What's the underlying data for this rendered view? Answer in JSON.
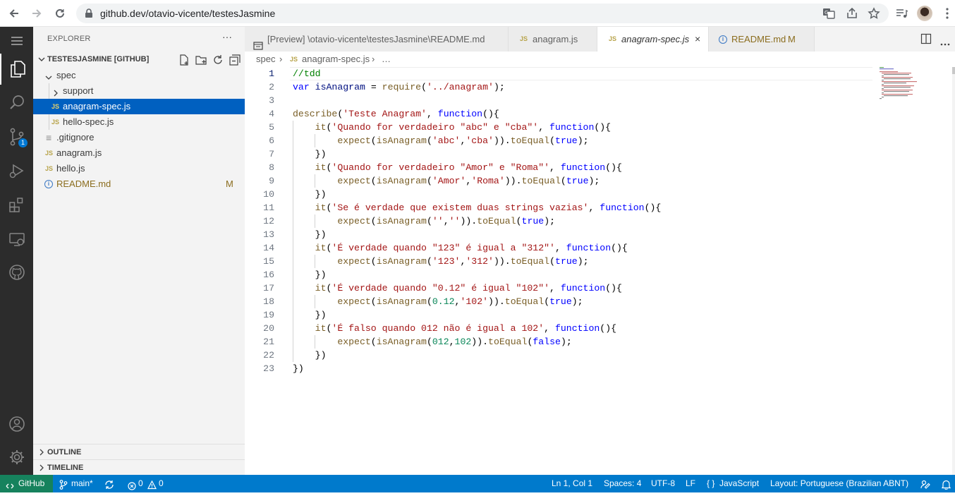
{
  "browser": {
    "url": "github.dev/otavio-vicente/testesJasmine"
  },
  "activity_bar": {
    "source_control_badge": "1"
  },
  "explorer": {
    "title": "EXPLORER",
    "more": "···",
    "section_title": "TESTESJASMINE [GITHUB]",
    "tree": [
      {
        "name": "spec",
        "type": "folder-open"
      },
      {
        "name": "support",
        "type": "folder"
      },
      {
        "name": "anagram-spec.js",
        "type": "js"
      },
      {
        "name": "hello-spec.js",
        "type": "js"
      },
      {
        "name": ".gitignore",
        "type": "file"
      },
      {
        "name": "anagram.js",
        "type": "js"
      },
      {
        "name": "hello.js",
        "type": "js"
      },
      {
        "name": "README.md",
        "type": "info",
        "status": "M"
      }
    ],
    "js_glyph": "JS",
    "outline": "OUTLINE",
    "timeline": "TIMELINE"
  },
  "tabs": [
    {
      "label": "[Preview] \\otavio-vicente\\testesJasmine\\README.md",
      "icon": "preview"
    },
    {
      "label": "anagram.js",
      "icon": "JS"
    },
    {
      "label": "anagram-spec.js",
      "icon": "JS",
      "active": true,
      "close": "×"
    },
    {
      "label": "README.md",
      "icon": "info",
      "status": "M"
    }
  ],
  "breadcrumb": {
    "folder": "spec",
    "sep": "›",
    "file": "anagram-spec.js",
    "more": "…"
  },
  "editor": {
    "line_numbers": [
      "1",
      "2",
      "3",
      "4",
      "5",
      "6",
      "7",
      "8",
      "9",
      "10",
      "11",
      "12",
      "13",
      "14",
      "15",
      "16",
      "17",
      "18",
      "19",
      "20",
      "21",
      "22",
      "23"
    ]
  },
  "status_bar": {
    "remote": "GitHub",
    "branch": "main*",
    "errors": "0",
    "warnings": "0",
    "position": "Ln 1, Col 1",
    "spaces": "Spaces: 4",
    "encoding": "UTF-8",
    "eol": "LF",
    "language": "JavaScript",
    "layout": "Layout: Portuguese (Brazilian ABNT)"
  },
  "colors": {
    "status_bar": "#007acc",
    "remote": "#16825d",
    "selection": "#0060c0"
  }
}
